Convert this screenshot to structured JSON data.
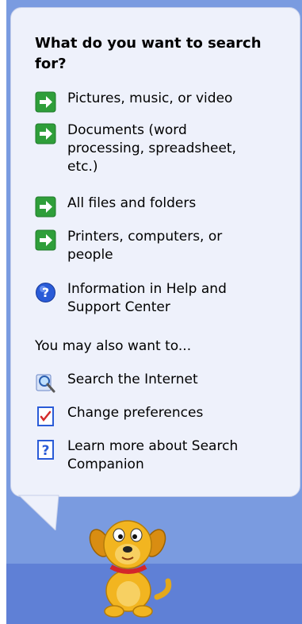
{
  "panel": {
    "title": "What do you want to search for?",
    "search_items": [
      {
        "label": "Pictures, music, or video",
        "icon": "green-arrow-icon"
      },
      {
        "label": "Documents (word processing, spreadsheet, etc.)",
        "icon": "green-arrow-icon"
      },
      {
        "label": "All files and folders",
        "icon": "green-arrow-icon"
      },
      {
        "label": "Printers, computers, or people",
        "icon": "green-arrow-icon"
      },
      {
        "label": "Information in Help and Support Center",
        "icon": "help-question-icon"
      }
    ],
    "also_heading": "You may also want to...",
    "also_items": [
      {
        "label": "Search the Internet",
        "icon": "search-magnifier-icon"
      },
      {
        "label": "Change preferences",
        "icon": "checklist-icon"
      },
      {
        "label": "Learn more about Search Companion",
        "icon": "question-doc-icon"
      }
    ]
  },
  "colors": {
    "pane_blue": "#7a9be0",
    "bubble_bg": "#eef1fb",
    "arrow_green": "#2f9e3a",
    "help_blue": "#2a5bd7"
  }
}
